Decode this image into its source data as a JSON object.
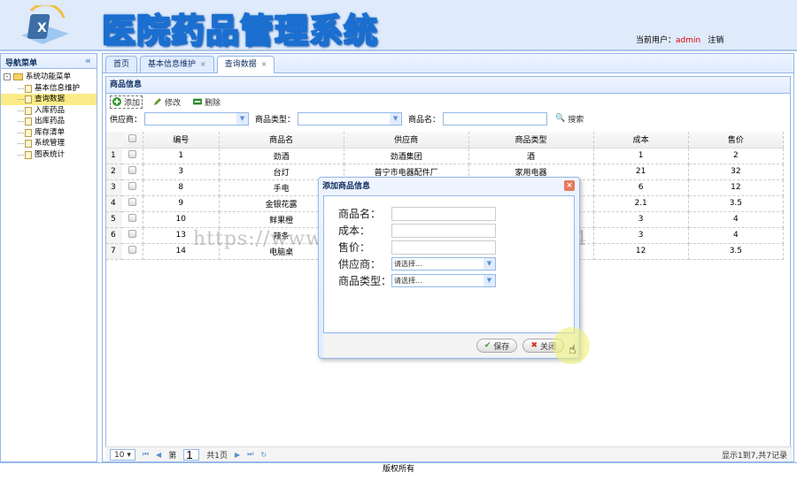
{
  "header": {
    "title": "医院药品管理系统",
    "user_label": "当前用户：",
    "user_name": "admin",
    "logout": "注销"
  },
  "nav": {
    "title": "导航菜单",
    "root": "系统功能菜单",
    "items": [
      {
        "label": "基本信息维护"
      },
      {
        "label": "查询数据",
        "selected": true
      },
      {
        "label": "入库药品"
      },
      {
        "label": "出库药品"
      },
      {
        "label": "库存清单"
      },
      {
        "label": "系统管理"
      },
      {
        "label": "图表统计"
      }
    ]
  },
  "tabs": [
    {
      "label": "首页"
    },
    {
      "label": "基本信息维护",
      "closable": true
    },
    {
      "label": "查询数据",
      "closable": true,
      "active": true
    }
  ],
  "panel": {
    "title": "商品信息"
  },
  "toolbar": {
    "add": "添加",
    "edit": "修改",
    "delete": "删除"
  },
  "search": {
    "supplier_label": "供应商：",
    "type_label": "商品类型：",
    "name_label": "商品名：",
    "search_button": "搜索"
  },
  "table": {
    "columns": [
      "编号",
      "商品名",
      "供应商",
      "商品类型",
      "成本",
      "售价"
    ],
    "rows": [
      [
        "1",
        "1",
        "劲酒",
        "劲酒集团",
        "酒",
        "1",
        "2"
      ],
      [
        "2",
        "3",
        "台灯",
        "普宁市电器配件厂",
        "家用电器",
        "21",
        "32"
      ],
      [
        "3",
        "8",
        "手电",
        "",
        "",
        "6",
        "12"
      ],
      [
        "4",
        "9",
        "金银花露",
        "",
        "",
        "2.1",
        "3.5"
      ],
      [
        "5",
        "10",
        "鲜果橙",
        "",
        "",
        "3",
        "4"
      ],
      [
        "6",
        "13",
        "辣条",
        "",
        "",
        "3",
        "4"
      ],
      [
        "7",
        "14",
        "电脑桌",
        "",
        "",
        "12",
        "3.5"
      ]
    ]
  },
  "pager": {
    "page_size": "10",
    "page_prefix": "第",
    "page": "1",
    "page_suffix": "共1页",
    "info": "显示1到7,共7记录"
  },
  "footer": "版权所有",
  "dialog": {
    "title": "添加商品信息",
    "fields": {
      "name": "商品名：",
      "cost": "成本：",
      "price": "售价：",
      "supplier": "供应商：",
      "type": "商品类型："
    },
    "placeholder": "请选择...",
    "save": "保存",
    "close": "关闭"
  },
  "watermark": "https://www.huzhan.com/ishop14144"
}
